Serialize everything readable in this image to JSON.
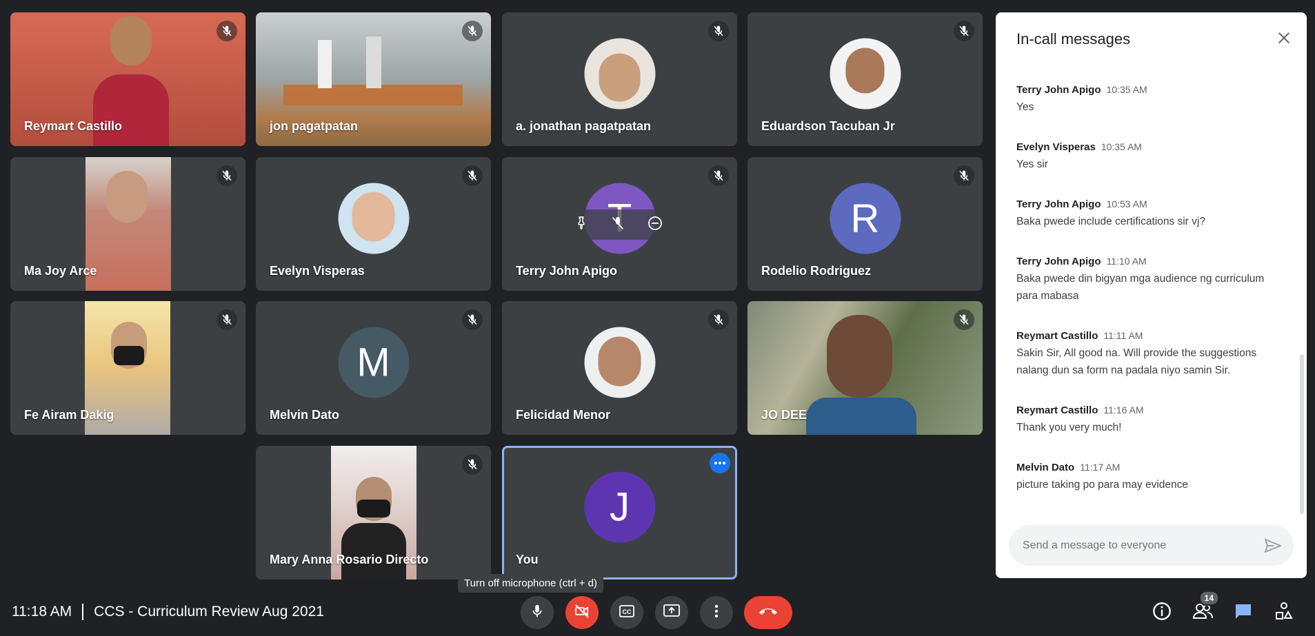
{
  "participants": [
    {
      "name": "Reymart Castillo"
    },
    {
      "name": "jon pagatpatan"
    },
    {
      "name": "a. jonathan pagatpatan"
    },
    {
      "name": "Eduardson Tacuban Jr"
    },
    {
      "name": "Ma Joy Arce"
    },
    {
      "name": "Evelyn Visperas"
    },
    {
      "name": "Terry John Apigo",
      "initial": "T"
    },
    {
      "name": "Rodelio Rodriguez",
      "initial": "R"
    },
    {
      "name": "Fe Airam Dakig"
    },
    {
      "name": "Melvin Dato",
      "initial": "M"
    },
    {
      "name": "Felicidad Menor"
    },
    {
      "name": "JO DEE"
    },
    {
      "name": "Mary Anna Rosario Directo"
    },
    {
      "name": "You",
      "initial": "J"
    }
  ],
  "chat": {
    "title": "In-call messages",
    "messages": [
      {
        "sender": "Terry John Apigo",
        "time": "10:35 AM",
        "text": "Yes"
      },
      {
        "sender": "Evelyn Visperas",
        "time": "10:35 AM",
        "text": "Yes sir"
      },
      {
        "sender": "Terry John Apigo",
        "time": "10:53 AM",
        "text": "Baka pwede include certifications sir vj?"
      },
      {
        "sender": "Terry John Apigo",
        "time": "11:10 AM",
        "text": "Baka pwede din bigyan mga audience ng curriculum para mabasa"
      },
      {
        "sender": "Reymart Castillo",
        "time": "11:11 AM",
        "text": "Sakin Sir, All good na. Will provide the suggestions nalang dun sa form na padala niyo samin Sir."
      },
      {
        "sender": "Reymart Castillo",
        "time": "11:16 AM",
        "text": "Thank you very much!"
      },
      {
        "sender": "Melvin Dato",
        "time": "11:17 AM",
        "text": "picture taking po para may evidence"
      }
    ],
    "input_placeholder": "Send a message to everyone"
  },
  "meeting": {
    "time": "11:18 AM",
    "title": "CCS - Curriculum Review Aug 2021"
  },
  "tooltip": "Turn off microphone (ctrl + d)",
  "people_count": "14",
  "colors": {
    "accent": "#1a73e8",
    "danger": "#ea4335",
    "tile": "#3c4043",
    "background": "#202124",
    "avatar_R": "#5c6bc0",
    "avatar_M": "#455a64",
    "avatar_J": "#5e35b1",
    "avatar_T": "#7e57c2"
  },
  "icons": [
    "mic-off-icon",
    "more-horizontal-icon",
    "pin-icon",
    "minus-circle-icon",
    "close-icon",
    "send-icon",
    "mic-icon",
    "videocam-off-icon",
    "captions-icon",
    "present-icon",
    "more-vert-icon",
    "call-end-icon",
    "info-icon",
    "people-icon",
    "chat-icon",
    "activities-icon"
  ]
}
